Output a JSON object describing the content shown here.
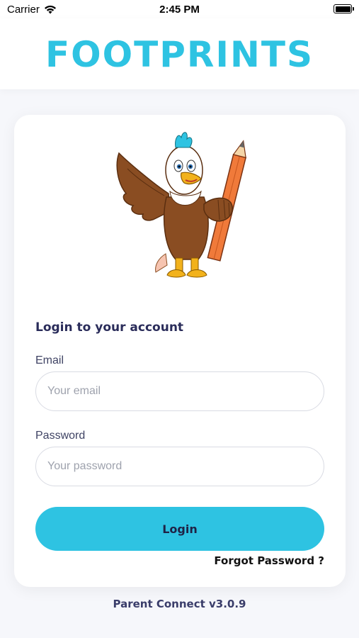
{
  "status_bar": {
    "carrier": "Carrier",
    "time": "2:45 PM",
    "icons": [
      "wifi-icon",
      "battery-icon"
    ]
  },
  "header": {
    "brand": "FOOTPRINTS"
  },
  "mascot": {
    "description_icon": "eagle-mascot-with-pencil"
  },
  "form": {
    "title": "Login to your account",
    "email_label": "Email",
    "email_placeholder": "Your email",
    "email_value": "",
    "password_label": "Password",
    "password_placeholder": "Your password",
    "password_value": "",
    "login_label": "Login",
    "forgot_label": "Forgot Password ?"
  },
  "footer": {
    "version_text": "Parent Connect v3.0.9"
  },
  "colors": {
    "brand": "#2ec3e2",
    "title": "#2a2c5a",
    "background": "#f6f7fb"
  }
}
